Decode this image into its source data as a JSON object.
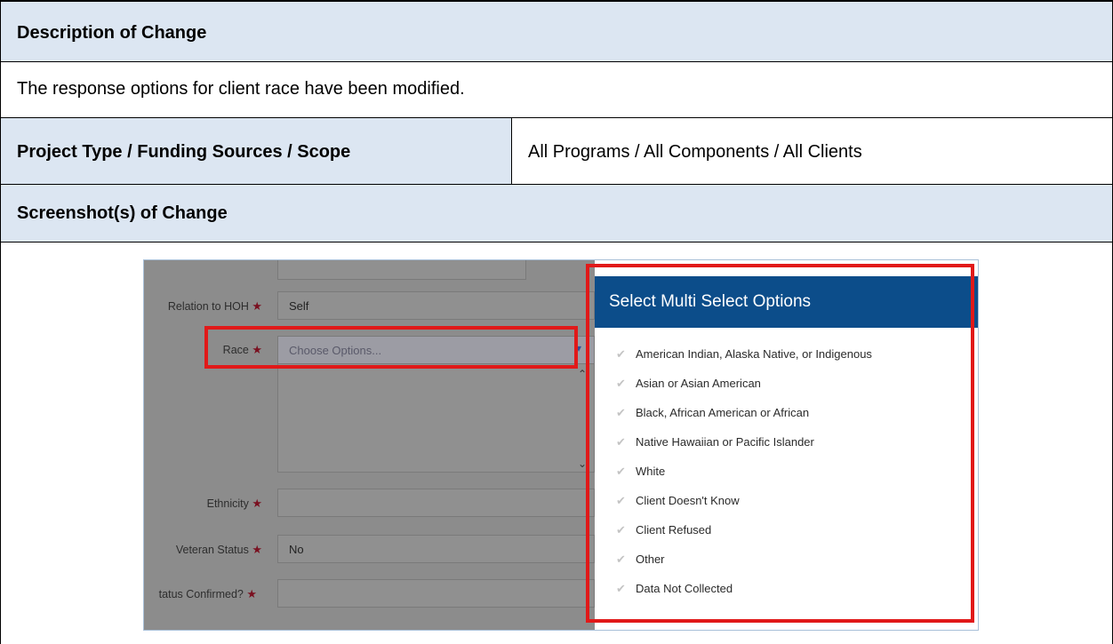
{
  "rows": {
    "description_header": "Description of Change",
    "description_text": "The response options for client race have been modified.",
    "scope_label": "Project Type / Funding Sources / Scope",
    "scope_value": "All Programs / All Components / All Clients",
    "screenshot_header": "Screenshot(s) of Change"
  },
  "form": {
    "relation_label": "Relation to HOH",
    "relation_value": "Self",
    "race_label": "Race",
    "race_placeholder": "Choose Options...",
    "ethnicity_label": "Ethnicity",
    "veteran_label": "Veteran Status",
    "veteran_value": "No",
    "status_label": "tatus Confirmed?",
    "required_mark": "★"
  },
  "modal": {
    "title": "Select Multi Select Options",
    "options": [
      "American Indian, Alaska Native, or Indigenous",
      "Asian or Asian American",
      "Black, African American or African",
      "Native Hawaiian or Pacific Islander",
      "White",
      "Client Doesn't Know",
      "Client Refused",
      "Other",
      "Data Not Collected"
    ],
    "check_icon": "✔"
  },
  "colors": {
    "header_bg": "#dce6f2",
    "modal_header": "#0c4d8a",
    "highlight": "#e11919"
  }
}
